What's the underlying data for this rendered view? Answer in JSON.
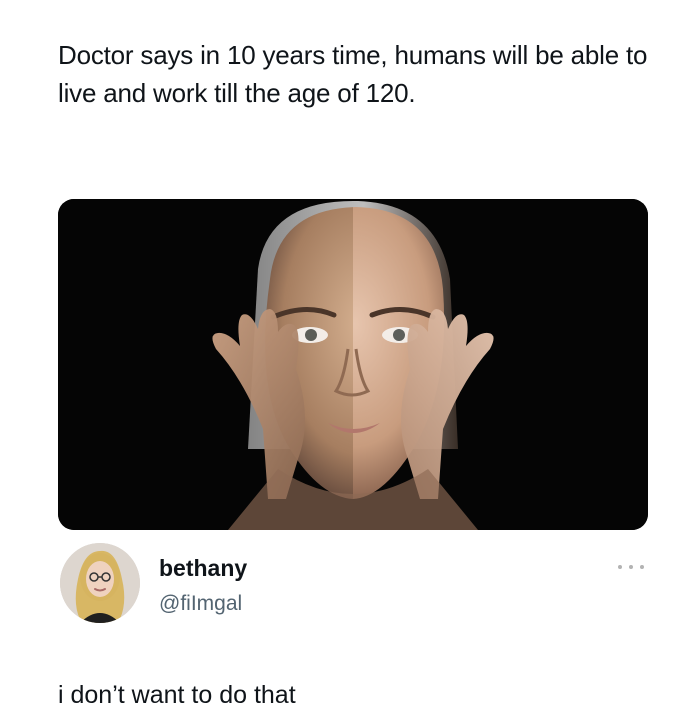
{
  "post": {
    "text": "Doctor says in 10 years time, humans will be able to live and work till the age of 120.",
    "media": {
      "description_icon": "photo-icon"
    }
  },
  "reply": {
    "author_name": "bethany",
    "author_handle": "@fiImgal",
    "text": "i don’t want to do that",
    "more_icon": "more-icon"
  },
  "colors": {
    "text_primary": "#0f1419",
    "text_secondary": "#536471",
    "media_background": "#050505"
  }
}
